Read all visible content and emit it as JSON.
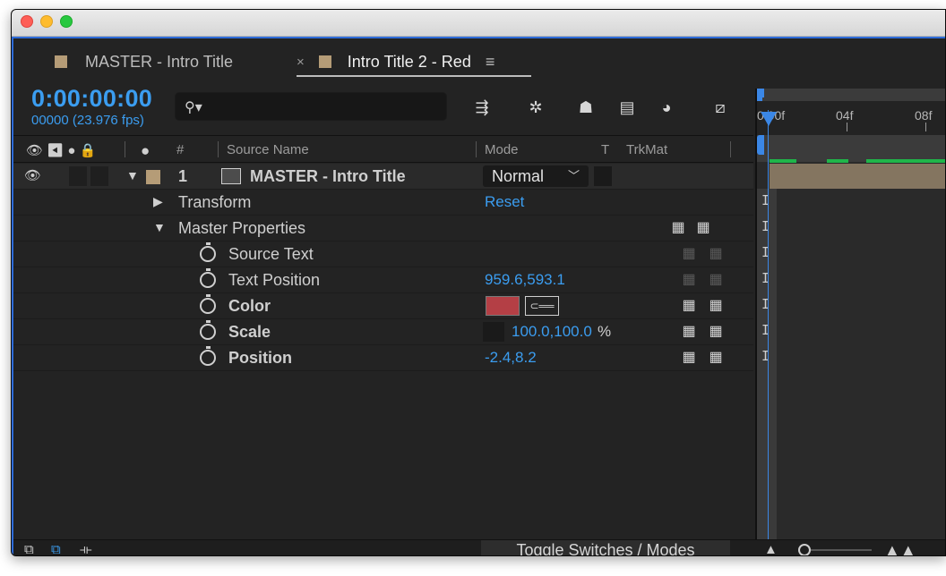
{
  "tabs": [
    {
      "label": "MASTER - Intro Title"
    },
    {
      "label": "Intro Title 2 - Red",
      "close": "×",
      "menu": "≡"
    }
  ],
  "timecode": "0:00:00:00",
  "fps": "00000 (23.976 fps)",
  "search": {
    "placeholder": ""
  },
  "columns": {
    "num": "#",
    "source_name": "Source Name",
    "mode": "Mode",
    "t": "T",
    "trkmat": "TrkMat"
  },
  "layer": {
    "number": "1",
    "name": "MASTER - Intro Title",
    "mode": "Normal"
  },
  "properties": {
    "transform": {
      "label": "Transform",
      "value": "Reset"
    },
    "master": {
      "label": "Master Properties"
    },
    "source_text": {
      "label": "Source Text"
    },
    "text_position": {
      "label": "Text Position",
      "value": "959.6,593.1"
    },
    "color": {
      "label": "Color",
      "swatch": "#b43f45"
    },
    "scale": {
      "label": "Scale",
      "value": "100.0,100.0",
      "unit": "%"
    },
    "position": {
      "label": "Position",
      "value": "-2.4,8.2"
    }
  },
  "ruler": {
    "labels": [
      "0:00f",
      "04f",
      "08f"
    ]
  },
  "bottom": {
    "toggle": "Toggle Switches / Modes"
  },
  "colors": {
    "accent": "#3b9df0",
    "label_tan": "#b59c77",
    "work_area": "#1fb64a"
  },
  "icons": [
    "eye-icon",
    "audio-icon",
    "solo-icon",
    "lock-icon",
    "label-icon",
    "stopwatch-icon",
    "push-icon",
    "pull-icon",
    "eyedropper-icon"
  ]
}
